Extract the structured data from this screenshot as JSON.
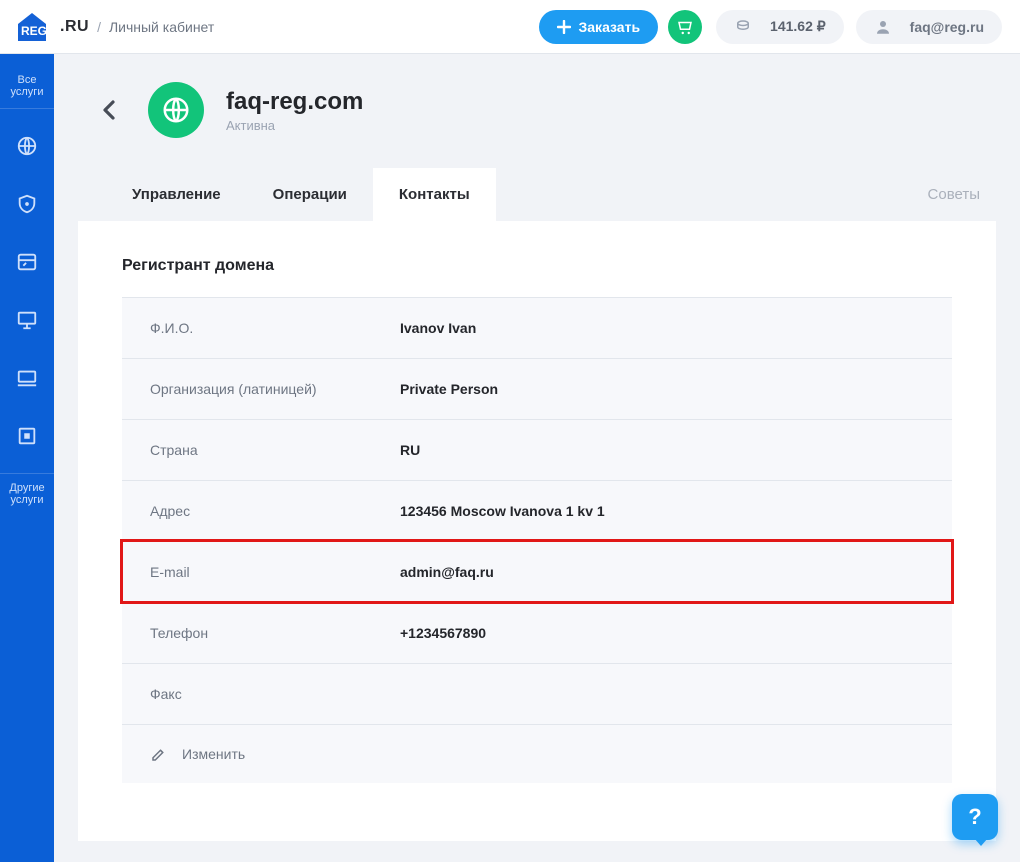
{
  "topbar": {
    "logo_ru": ".RU",
    "breadcrumb": "Личный кабинет",
    "order_label": "Заказать",
    "balance": "141.62 ₽",
    "account_email": "faq@reg.ru"
  },
  "sidebar": {
    "all_services": "Все услуги",
    "other_services": "Другие услуги"
  },
  "domain": {
    "name": "faq-reg.com",
    "status": "Активна"
  },
  "tabs": {
    "manage": "Управление",
    "operations": "Операции",
    "contacts": "Контакты",
    "tips": "Советы"
  },
  "section": {
    "registrant_title": "Регистрант домена",
    "edit_label": "Изменить"
  },
  "rows": [
    {
      "label": "Ф.И.О.",
      "value": "Ivanov Ivan"
    },
    {
      "label": "Организация (латиницей)",
      "value": "Private Person"
    },
    {
      "label": "Страна",
      "value": "RU"
    },
    {
      "label": "Адрес",
      "value": "123456 Moscow Ivanova 1 kv 1"
    },
    {
      "label": "E-mail",
      "value": "admin@faq.ru"
    },
    {
      "label": "Телефон",
      "value": "+1234567890"
    },
    {
      "label": "Факс",
      "value": ""
    }
  ],
  "highlight_index": 4,
  "help": {
    "label": "?"
  }
}
